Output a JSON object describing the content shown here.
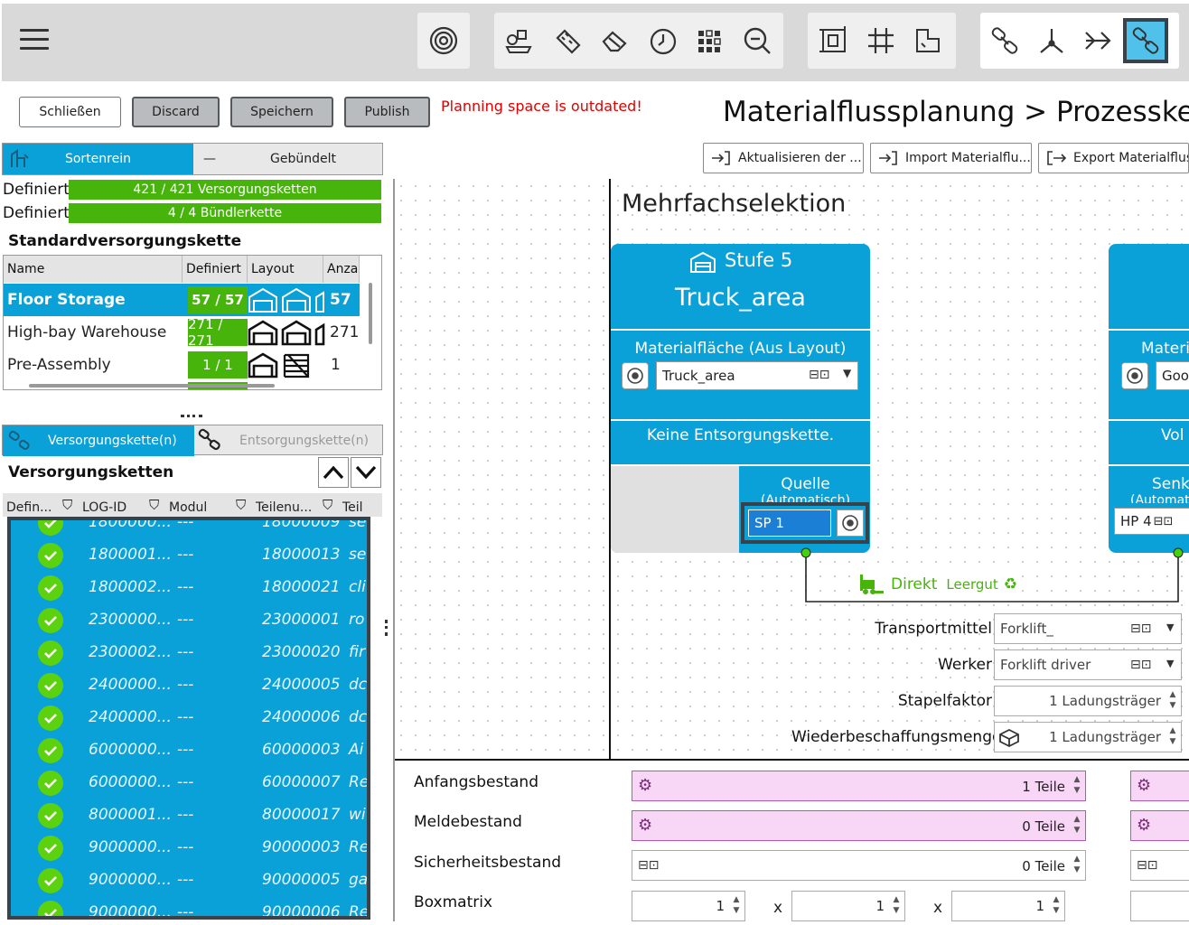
{
  "toolbar": {
    "menu_icon": "hamburger-menu-icon",
    "groups": [
      [
        "target-icon"
      ],
      [
        "parts-icon",
        "ruler-icon",
        "eraser-icon",
        "clock-icon",
        "grid-dots-icon",
        "magnifier-icon"
      ],
      [
        "layout-frame-icon",
        "grid-icon",
        "area-icon"
      ],
      [
        "chain-icon",
        "merge-icon",
        "arrow-right-icon",
        "chain-active-icon"
      ]
    ]
  },
  "actions": {
    "close": "Schließen",
    "discard": "Discard",
    "save": "Speichern",
    "publish": "Publish"
  },
  "warning": "Planning space is outdated!",
  "breadcrumb": "Materialflussplanung  >  Prozesskette",
  "left": {
    "tabs": {
      "sortenrein": "Sortenrein",
      "gebuendelt": "Gebündelt",
      "dash": "—"
    },
    "progress": [
      {
        "label": "Definiert",
        "value": "421 / 421 Versorgungsketten"
      },
      {
        "label": "Definiert",
        "value": "4 / 4 Bündlerkette"
      }
    ],
    "standard_title": "Standardversorgungskette",
    "std_headers": [
      "Name",
      "Definiert",
      "Layout",
      "Anza"
    ],
    "std_rows": [
      {
        "name": "Floor Storage",
        "def": "57 / 57",
        "count": "57",
        "selected": true
      },
      {
        "name": "High-bay Warehouse",
        "def": "271 / 271",
        "count": "271",
        "selected": false
      },
      {
        "name": "Pre-Assembly",
        "def": "1 / 1",
        "count": "1",
        "selected": false
      }
    ],
    "chain_tabs": {
      "supply": "Versorgungskette(n)",
      "disposal": "Entsorgungskette(n)"
    },
    "chain_title": "Versorgungsketten",
    "list_headers": [
      "Defin...",
      "LOG-ID",
      "Modul",
      "Teilenu...",
      "Teil"
    ],
    "list_rows": [
      {
        "log": "1800000...",
        "modul": "---",
        "teil": "18000009",
        "x": "se"
      },
      {
        "log": "1800001...",
        "modul": "---",
        "teil": "18000013",
        "x": "se"
      },
      {
        "log": "1800002...",
        "modul": "---",
        "teil": "18000021",
        "x": "cli"
      },
      {
        "log": "2300000...",
        "modul": "---",
        "teil": "23000001",
        "x": "ro"
      },
      {
        "log": "2300002...",
        "modul": "---",
        "teil": "23000020",
        "x": "fir"
      },
      {
        "log": "2400000...",
        "modul": "---",
        "teil": "24000005",
        "x": "dc"
      },
      {
        "log": "2400000...",
        "modul": "---",
        "teil": "24000006",
        "x": "dc"
      },
      {
        "log": "6000000...",
        "modul": "---",
        "teil": "60000003",
        "x": "Ai"
      },
      {
        "log": "6000000...",
        "modul": "---",
        "teil": "60000007",
        "x": "Re"
      },
      {
        "log": "8000001...",
        "modul": "---",
        "teil": "80000017",
        "x": "wi"
      },
      {
        "log": "9000000...",
        "modul": "---",
        "teil": "90000003",
        "x": "Re"
      },
      {
        "log": "9000000...",
        "modul": "---",
        "teil": "90000005",
        "x": "ga"
      },
      {
        "log": "9000000...",
        "modul": "---",
        "teil": "90000006",
        "x": "Re"
      }
    ]
  },
  "toolbar2": {
    "refresh": "Aktualisieren der ...",
    "import": "Import Materialflu...",
    "export": "Export Materialflus"
  },
  "canvas": {
    "title": "Mehrfachselektion",
    "node1": {
      "stage": "Stufe 5",
      "name": "Truck_area",
      "material_label": "Materialfläche (Aus Layout)",
      "material_value": "Truck_area",
      "disposal": "Keine Entsorgungskette.",
      "source_label": "Quelle",
      "source_sub": "(Automatisch)",
      "sp": "SP 1"
    },
    "node2": {
      "material_label": "Materi",
      "material_value": "Goo",
      "vol": "Vol",
      "sink_label": "Senk",
      "sink_sub": "(Automat",
      "hp": "HP 4"
    },
    "transport": {
      "direct": "Direkt",
      "empty": "Leergut"
    },
    "props": [
      {
        "label": "Transportmittel",
        "value": "Forklift_"
      },
      {
        "label": "Werker",
        "value": "Forklift driver"
      },
      {
        "label": "Stapelfaktor",
        "value": "1 Ladungsträger"
      },
      {
        "label": "Wiederbeschaffungsmenge",
        "value": "1 Ladungsträger"
      }
    ]
  },
  "stock": [
    {
      "label": "Anfangsbestand",
      "value": "1 Teile"
    },
    {
      "label": "Meldebestand",
      "value": "0 Teile"
    },
    {
      "label": "Sicherheitsbestand",
      "value": "0 Teile"
    },
    {
      "label": "Boxmatrix",
      "values": [
        "1",
        "1",
        "1"
      ],
      "sep": "x"
    }
  ],
  "colors": {
    "accent": "#0aa0d8",
    "ok": "#46b40a",
    "warn": "#e00000",
    "pink": "#f8d6f6"
  }
}
